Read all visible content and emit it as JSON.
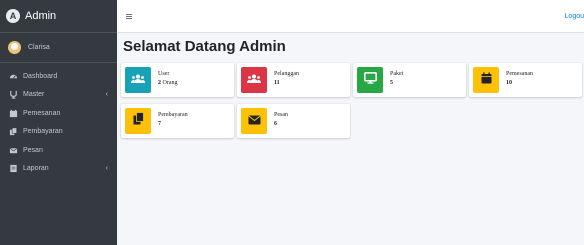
{
  "brand": {
    "name": "Admin"
  },
  "user": {
    "name": "Clarisa"
  },
  "sidebar": {
    "items": [
      {
        "label": "Dashboard",
        "icon": "dashboard-icon",
        "has_submenu": false
      },
      {
        "label": "Master",
        "icon": "master-icon",
        "has_submenu": true
      },
      {
        "label": "Pemesanan",
        "icon": "order-icon",
        "has_submenu": false
      },
      {
        "label": "Pembayaran",
        "icon": "payment-icon",
        "has_submenu": false
      },
      {
        "label": "Pesan",
        "icon": "message-icon",
        "has_submenu": false
      },
      {
        "label": "Laporan",
        "icon": "report-icon",
        "has_submenu": true
      }
    ],
    "chevron": "‹"
  },
  "topbar": {
    "logout_label": "Logou"
  },
  "page": {
    "title": "Selamat Datang Admin"
  },
  "cards": [
    {
      "label": "User",
      "value": "2",
      "unit": "Orang",
      "icon": "users-icon",
      "color": "#17a2b8"
    },
    {
      "label": "Pelanggan",
      "value": "11",
      "unit": "",
      "icon": "users-icon",
      "color": "#dc3545"
    },
    {
      "label": "Paket",
      "value": "5",
      "unit": "",
      "icon": "monitor-icon",
      "color": "#28a745"
    },
    {
      "label": "Pemesanan",
      "value": "10",
      "unit": "",
      "icon": "calendar-icon",
      "color": "#ffc107"
    },
    {
      "label": "Pembayaran",
      "value": "7",
      "unit": "",
      "icon": "copy-icon",
      "color": "#ffc107"
    },
    {
      "label": "Pesan",
      "value": "6",
      "unit": "",
      "icon": "envelope-icon",
      "color": "#ffc107"
    }
  ]
}
